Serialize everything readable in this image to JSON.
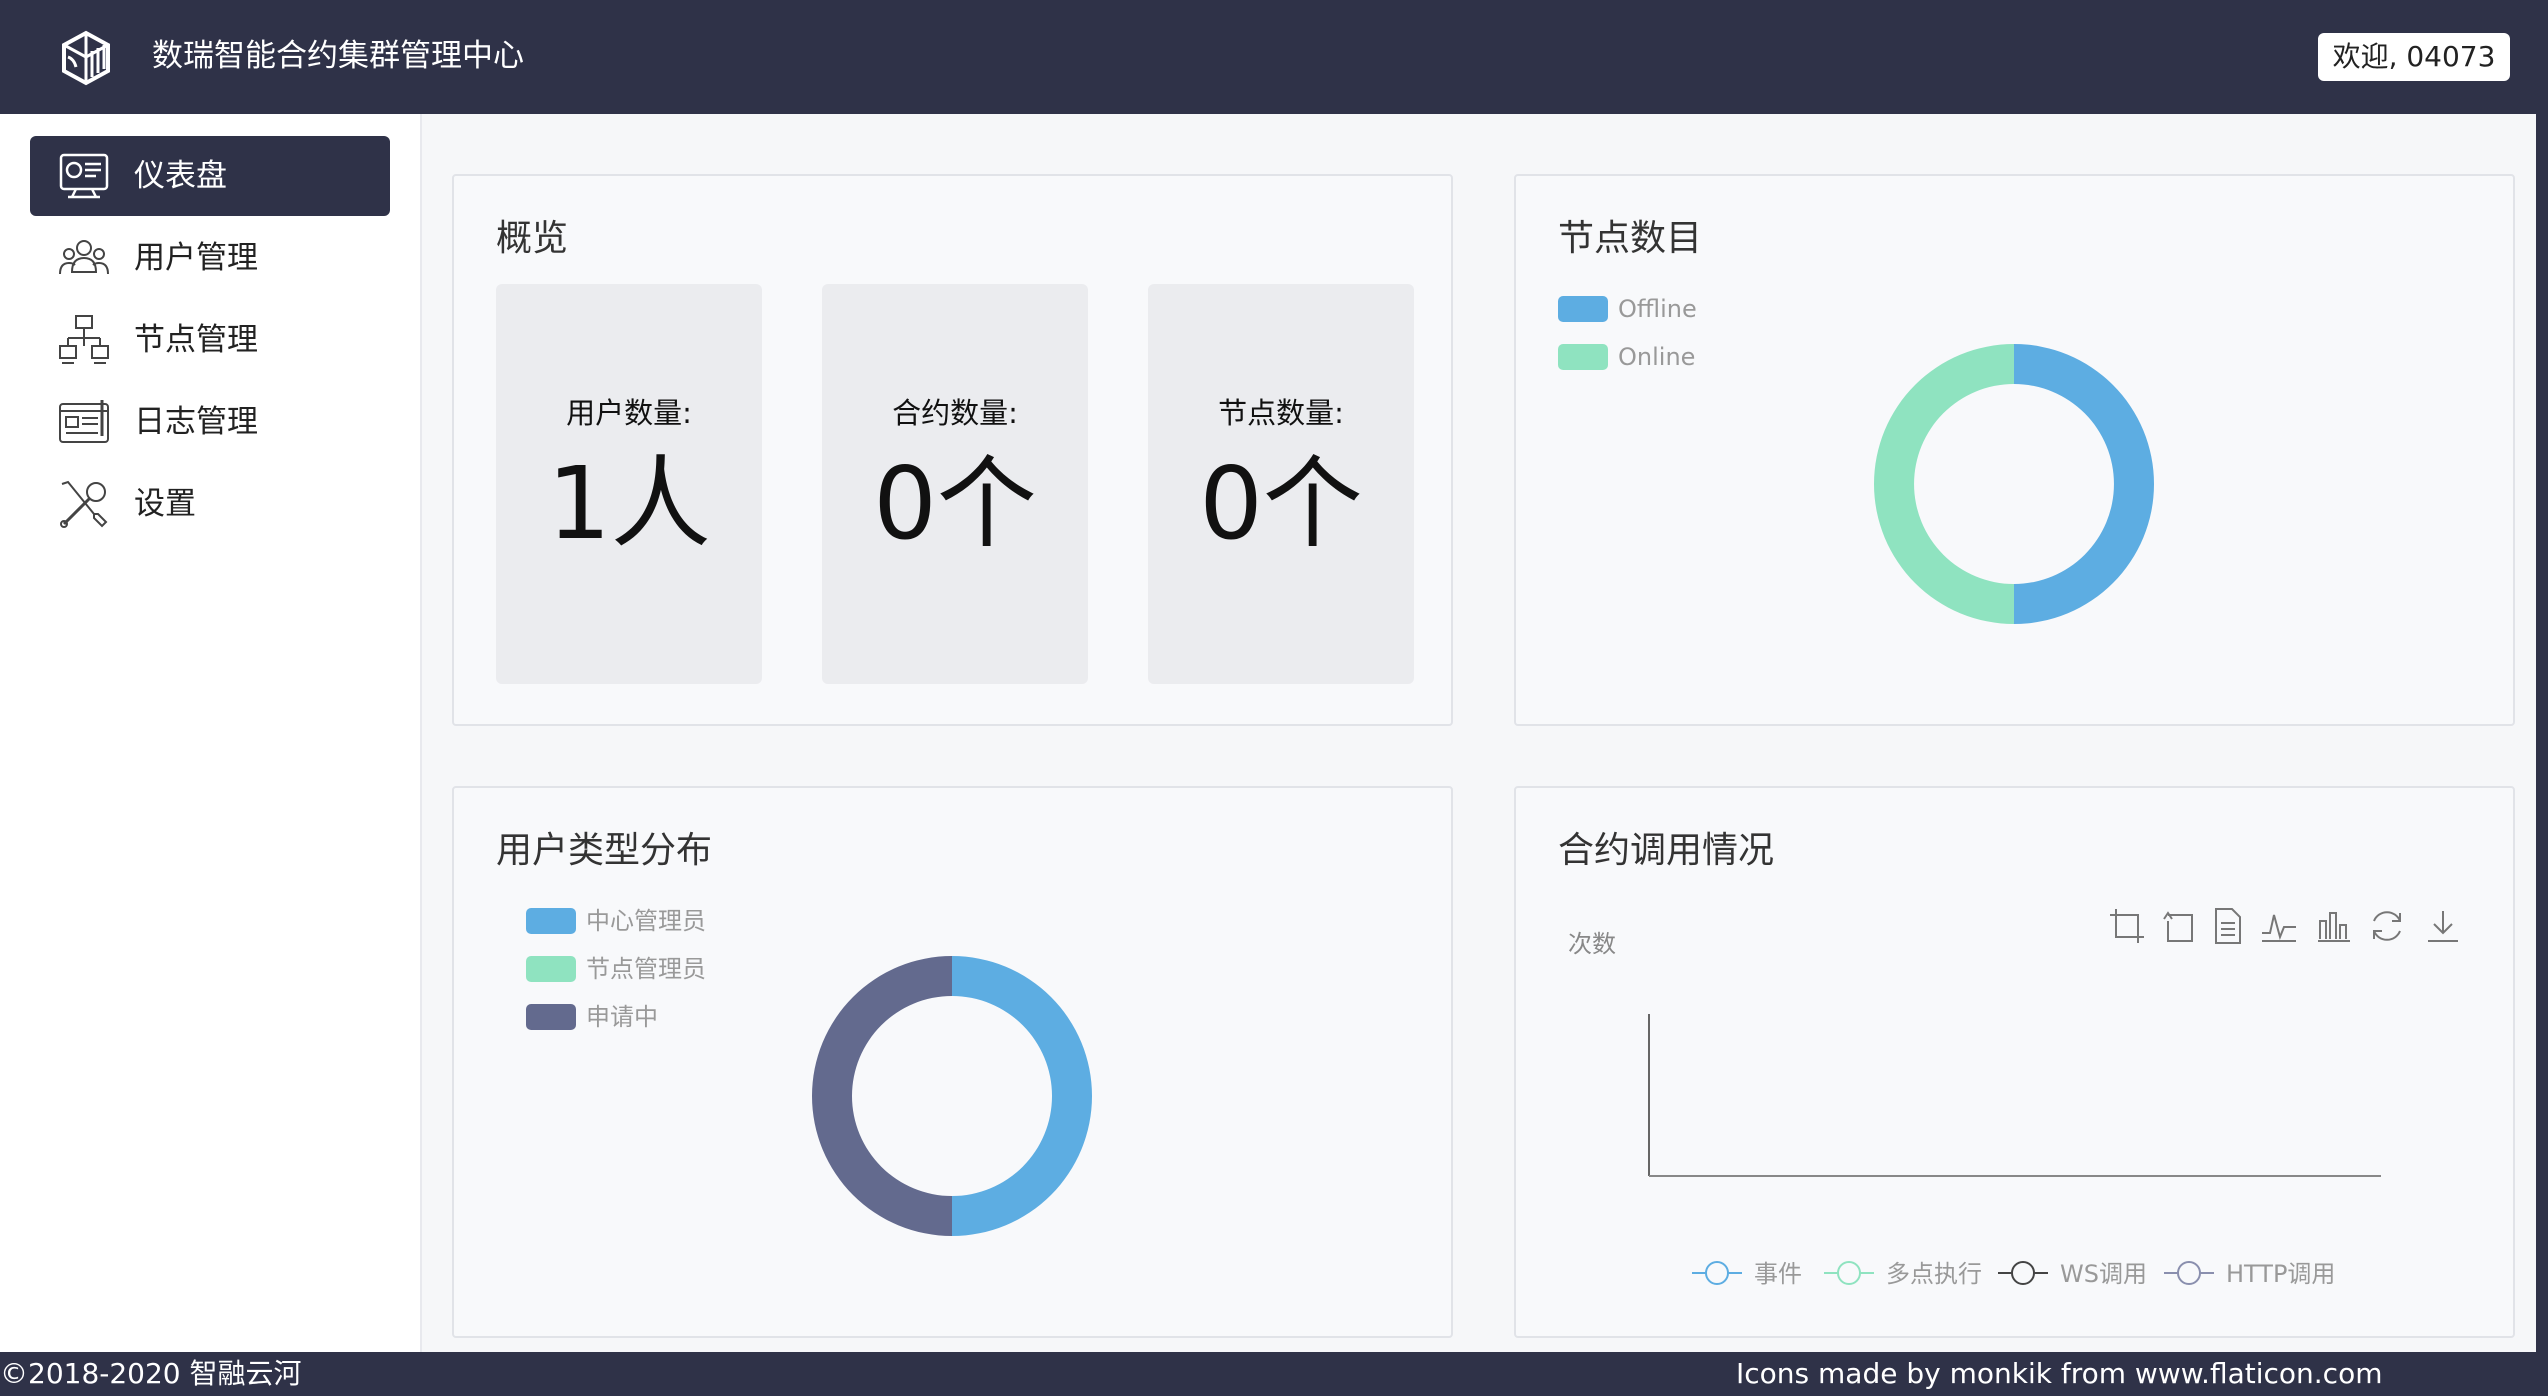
{
  "header": {
    "app_title": "数瑞智能合约集群管理中心",
    "welcome": "欢迎, 04073",
    "logo": "cube-logo"
  },
  "sidebar": {
    "items": [
      {
        "label": "仪表盘",
        "icon": "dashboard-icon",
        "active": true
      },
      {
        "label": "用户管理",
        "icon": "users-icon",
        "active": false
      },
      {
        "label": "节点管理",
        "icon": "network-icon",
        "active": false
      },
      {
        "label": "日志管理",
        "icon": "log-icon",
        "active": false
      },
      {
        "label": "设置",
        "icon": "tools-icon",
        "active": false
      }
    ]
  },
  "overview": {
    "title": "概览",
    "stats": [
      {
        "label": "用户数量:",
        "value": "1人"
      },
      {
        "label": "合约数量:",
        "value": "0个"
      },
      {
        "label": "节点数量:",
        "value": "0个"
      }
    ]
  },
  "node_count": {
    "title": "节点数目",
    "legend": [
      "Offline",
      "Online"
    ]
  },
  "user_types": {
    "title": "用户类型分布",
    "legend": [
      "中心管理员",
      "节点管理员",
      "申请中"
    ]
  },
  "contract_calls": {
    "title": "合约调用情况",
    "y_label": "次数",
    "legend": [
      "事件",
      "多点执行",
      "WS调用",
      "HTTP调用"
    ],
    "toolbox": [
      "zoom-icon",
      "zoom-reset-icon",
      "data-view-icon",
      "line-icon",
      "bar-icon",
      "refresh-icon",
      "download-icon"
    ]
  },
  "chart_data": [
    {
      "type": "pie",
      "title": "节点数目",
      "categories": [
        "Offline",
        "Online"
      ],
      "values": [
        1,
        1
      ],
      "colors": [
        "#5dade2",
        "#8fe3c0"
      ]
    },
    {
      "type": "pie",
      "title": "用户类型分布",
      "categories": [
        "中心管理员",
        "节点管理员",
        "申请中"
      ],
      "values": [
        1,
        0,
        1
      ],
      "colors": [
        "#5dade2",
        "#8fe3c0",
        "#636a8e"
      ]
    },
    {
      "type": "line",
      "title": "合约调用情况",
      "ylabel": "次数",
      "x": [],
      "series": [
        {
          "name": "事件",
          "values": []
        },
        {
          "name": "多点执行",
          "values": []
        },
        {
          "name": "WS调用",
          "values": []
        },
        {
          "name": "HTTP调用",
          "values": []
        }
      ],
      "colors": [
        "#5dade2",
        "#8fe3c0",
        "#444444",
        "#8a8fae"
      ]
    }
  ],
  "footer": {
    "copyright": "©2018-2020 智融云河",
    "credits": "Icons made by monkik from www.flaticon.com"
  }
}
